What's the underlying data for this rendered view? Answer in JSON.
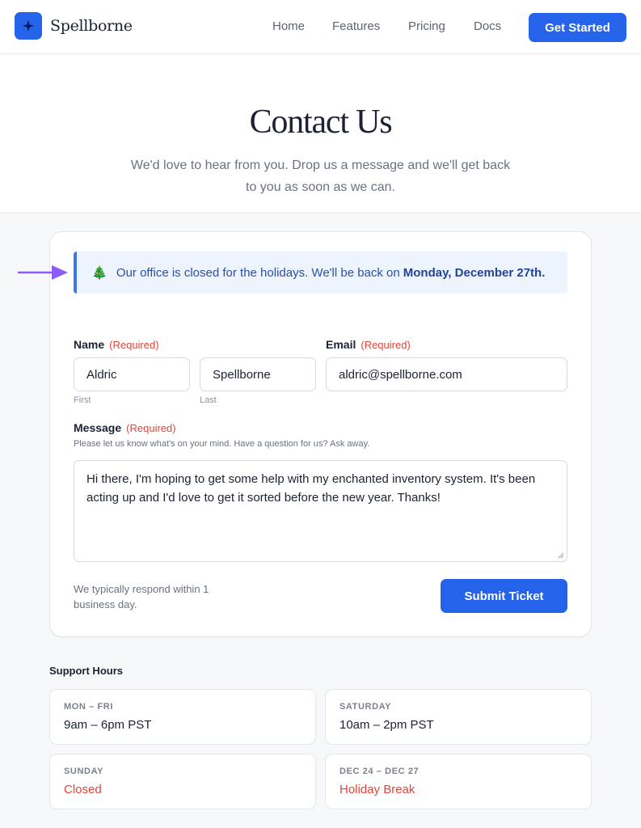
{
  "header": {
    "brand": "Spellborne",
    "nav": [
      "Home",
      "Features",
      "Pricing",
      "Docs"
    ],
    "cta": "Get Started"
  },
  "hero": {
    "title": "Contact Us",
    "subtitle": "We'd love to hear from you. Drop us a message and we'll get back to you as soon as we can."
  },
  "banner": {
    "icon": "christmas-tree",
    "text": "Our office is closed for the holidays. We'll be back on",
    "emphasis": "Monday, December 27th."
  },
  "form": {
    "name": {
      "label": "Name",
      "required": "(Required)",
      "first_value": "Aldric",
      "first_sublabel": "First",
      "last_value": "Spellborne",
      "last_sublabel": "Last"
    },
    "email": {
      "label": "Email",
      "required": "(Required)",
      "value": "aldric@spellborne.com"
    },
    "message": {
      "label": "Message",
      "required": "(Required)",
      "help": "Please let us know what's on your mind. Have a question for us? Ask away.",
      "value": "Hi there, I'm hoping to get some help with my enchanted inventory system. It's been acting up and I'd love to get it sorted before the new year. Thanks!"
    },
    "response_note": "We typically respond within 1 business day.",
    "submit": "Submit Ticket"
  },
  "support_hours": {
    "title": "Support Hours",
    "items": [
      {
        "day": "MON – FRI",
        "hours": "9am – 6pm PST",
        "alert": false
      },
      {
        "day": "SATURDAY",
        "hours": "10am – 2pm PST",
        "alert": false
      },
      {
        "day": "SUNDAY",
        "hours": "Closed",
        "alert": true
      },
      {
        "day": "DEC 24 – DEC 27",
        "hours": "Holiday Break",
        "alert": true
      }
    ]
  },
  "colors": {
    "accent": "#2563eb",
    "required": "#e0453a",
    "banner_bg": "#eef4fd",
    "annotation_arrow": "#8b5cf6"
  }
}
